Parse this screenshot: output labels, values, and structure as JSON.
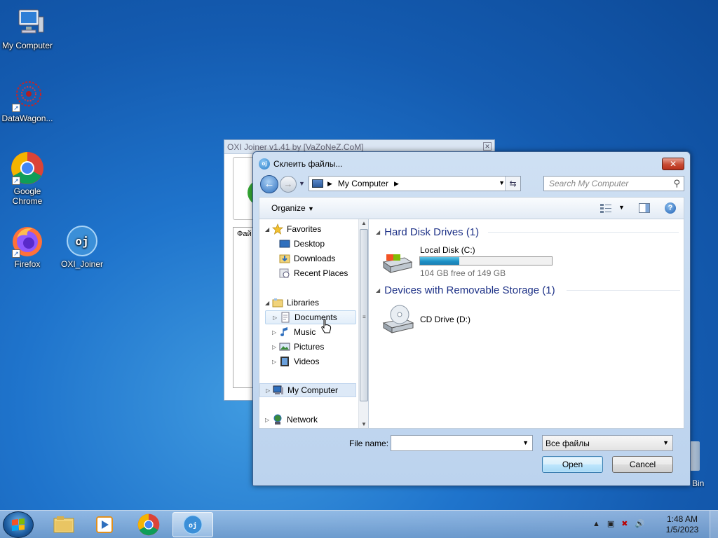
{
  "desktop": {
    "icons": [
      {
        "label": "My Computer"
      },
      {
        "label": "DataWagon..."
      },
      {
        "label": "Google Chrome"
      },
      {
        "label": "Firefox"
      },
      {
        "label": "OXI_Joiner"
      },
      {
        "label": "Bin"
      }
    ]
  },
  "bg_window": {
    "title": "OXI Joiner v1.41 by [VaZoNeZ.CoM]",
    "label": "Фай"
  },
  "dialog": {
    "title": "Склеить файлы...",
    "app_icon_text": "oj",
    "close": "✕",
    "address": {
      "current": "My Computer"
    },
    "search_placeholder": "Search My Computer",
    "toolbar": {
      "organize": "Organize"
    },
    "nav": {
      "favorites": "Favorites",
      "desktop": "Desktop",
      "downloads": "Downloads",
      "recent": "Recent Places",
      "libraries": "Libraries",
      "documents": "Documents",
      "music": "Music",
      "pictures": "Pictures",
      "videos": "Videos",
      "computer": "My Computer",
      "network": "Network"
    },
    "groups": {
      "hdd": "Hard Disk Drives (1)",
      "removable": "Devices with Removable Storage (1)"
    },
    "drives": [
      {
        "name": "Local Disk (C:)",
        "free": "104 GB free of 149 GB",
        "used_fraction": 0.3
      },
      {
        "name": "CD Drive (D:)"
      }
    ],
    "file_name_label": "File name:",
    "file_name_value": "",
    "file_type": "Все файлы",
    "open": "Open",
    "cancel": "Cancel"
  },
  "taskbar": {
    "time": "1:48 AM",
    "date": "1/5/2023",
    "tray_arrow": "▲",
    "oj_text": "oj"
  }
}
